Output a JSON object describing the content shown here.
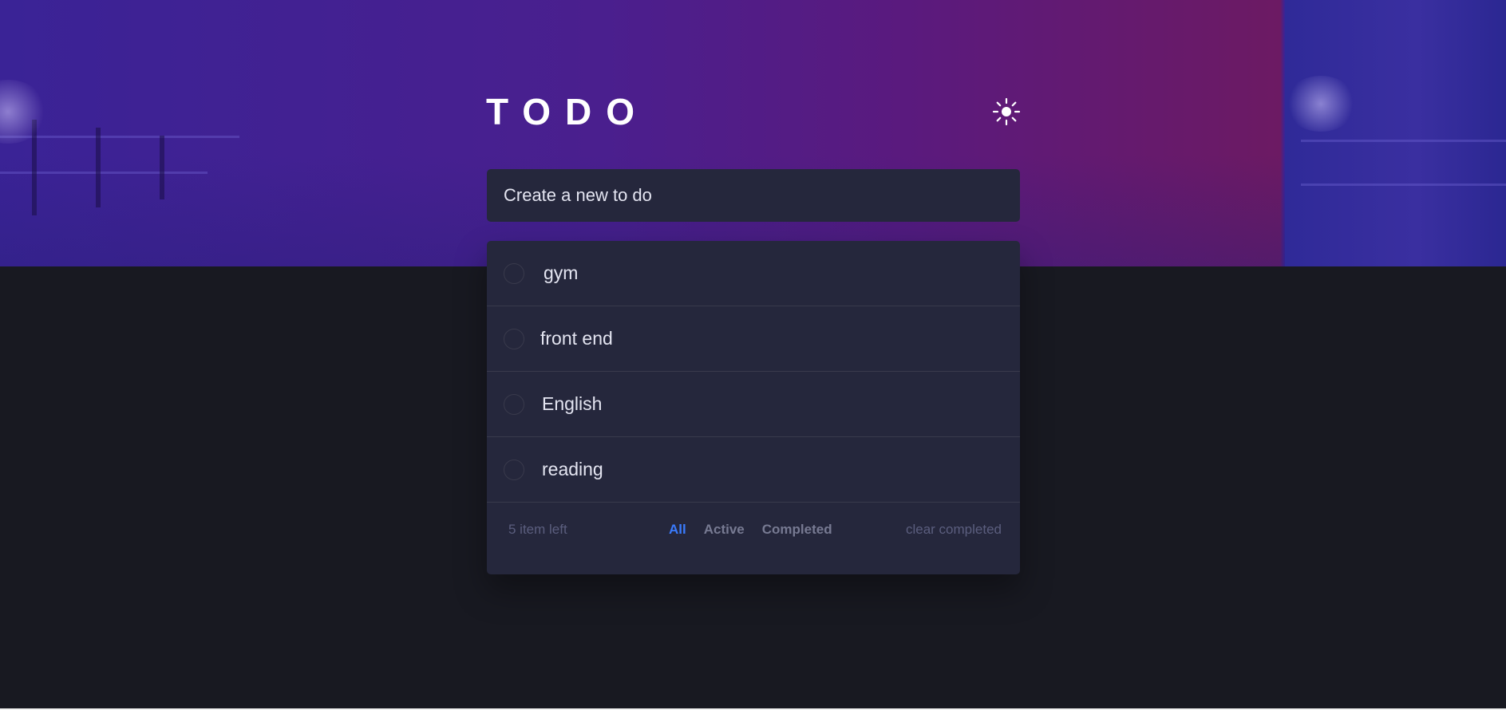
{
  "header": {
    "title": "TODO",
    "theme_toggle_icon": "sun-icon"
  },
  "new_todo": {
    "placeholder": "Create a new to do"
  },
  "todos": [
    {
      "text": "gym",
      "completed": false
    },
    {
      "text": "front end",
      "completed": false
    },
    {
      "text": "English",
      "completed": false
    },
    {
      "text": "reading",
      "completed": false
    }
  ],
  "footer": {
    "items_left": "5 item left",
    "filters": {
      "all": "All",
      "active": "Active",
      "completed": "Completed"
    },
    "clear_label": "clear completed"
  },
  "colors": {
    "accent": "#3a7bfd",
    "card": "#25273c",
    "page_background": "#181921",
    "divider": "#393a4c",
    "text": "#e4e5f1",
    "muted": "#5b5e7e"
  }
}
